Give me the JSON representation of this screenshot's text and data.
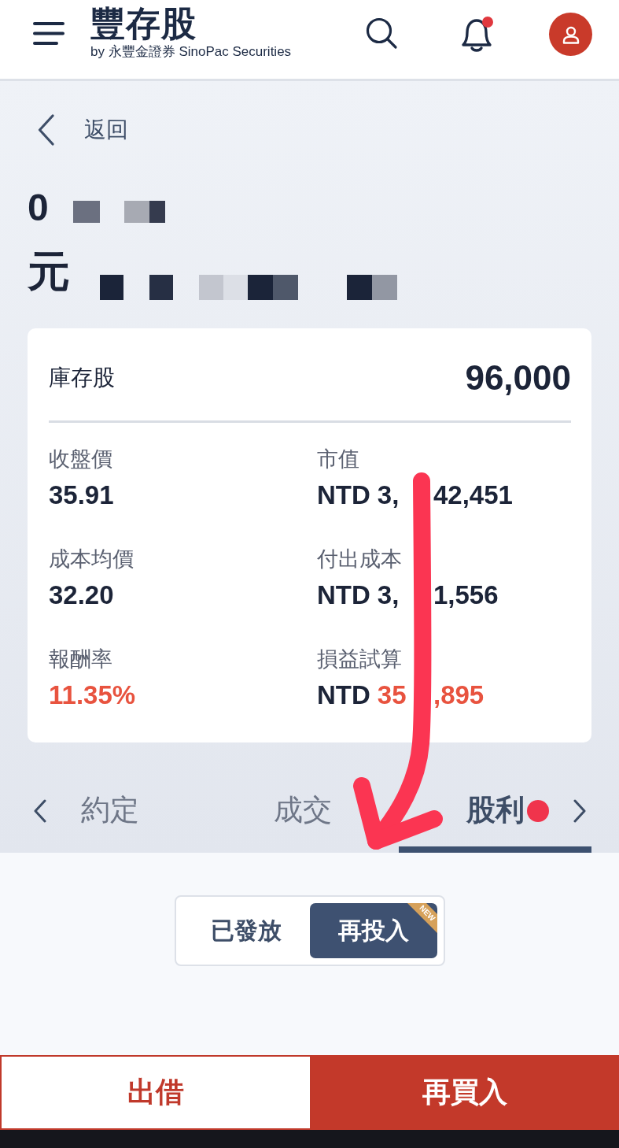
{
  "header": {
    "logo": "豐存股",
    "tagline": "by 永豐金證券 SinoPac Securities",
    "notifications_unread": true
  },
  "back": {
    "label": "返回"
  },
  "stock": {
    "code": "0",
    "name": "元"
  },
  "holding": {
    "label": "庫存股",
    "shares": "96,000",
    "fields": [
      {
        "label": "收盤價",
        "value_parts": [
          "35.91"
        ],
        "color": "#1c2438"
      },
      {
        "label": "市值",
        "currency": "NTD",
        "value_parts": [
          "3,",
          "42,451"
        ],
        "color": "#1c2438"
      },
      {
        "label": "成本均價",
        "value_parts": [
          "32.20"
        ],
        "color": "#1c2438"
      },
      {
        "label": "付出成本",
        "currency": "NTD",
        "value_parts": [
          "3,",
          "1,556"
        ],
        "color": "#1c2438"
      },
      {
        "label": "報酬率",
        "value_parts": [
          "11.35%"
        ],
        "color": "#e8533f"
      },
      {
        "label": "損益試算",
        "currency": "NTD",
        "value_parts": [
          "35",
          ",895"
        ],
        "color": "#e8533f"
      }
    ]
  },
  "tabs": [
    {
      "label": "約定",
      "selected": false,
      "dot": false
    },
    {
      "label": "成交",
      "selected": false,
      "dot": false
    },
    {
      "label": "股利",
      "selected": true,
      "dot": true
    }
  ],
  "segments": [
    {
      "label": "已發放",
      "selected": false
    },
    {
      "label": "再投入",
      "selected": true,
      "ribbon": "NEW"
    }
  ],
  "actions": [
    {
      "label": "出借",
      "kind": "outline"
    },
    {
      "label": "再買入",
      "kind": "filled"
    }
  ]
}
